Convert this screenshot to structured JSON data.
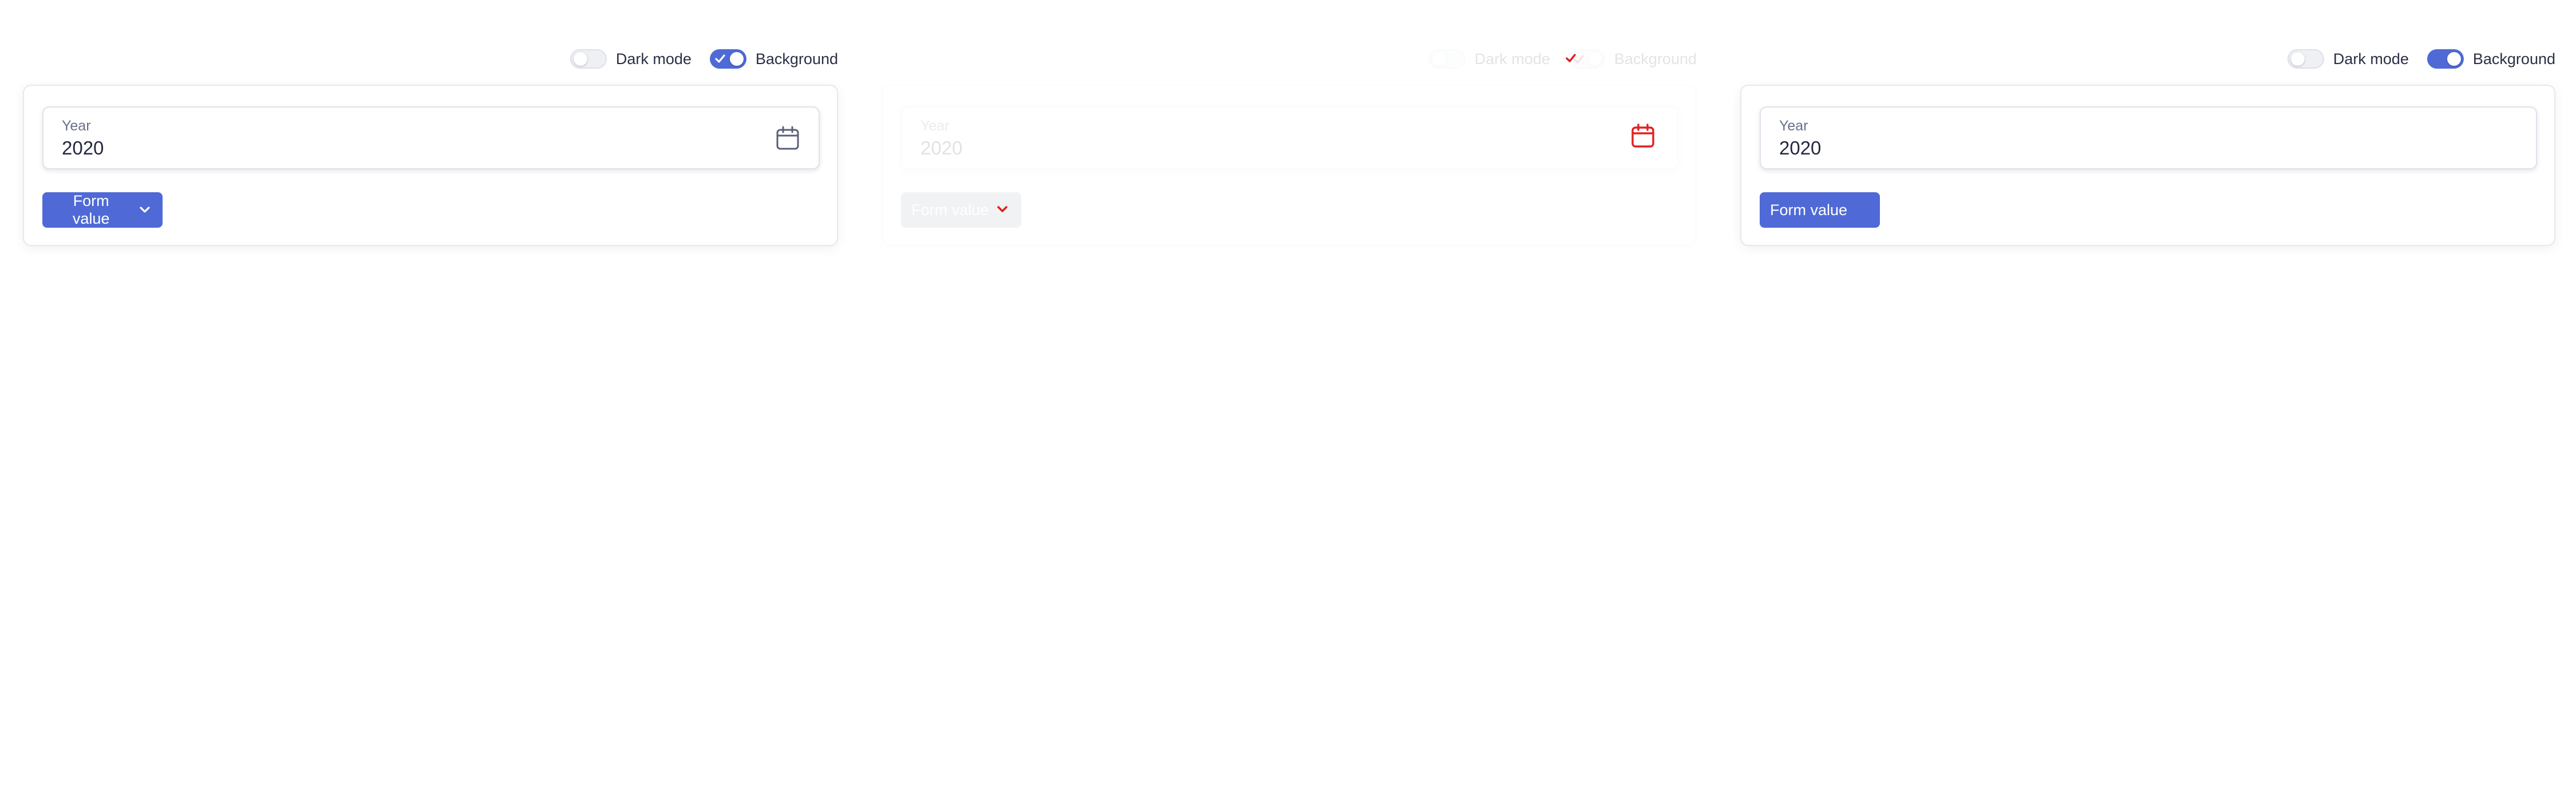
{
  "colors": {
    "accent": "#4f6ad6",
    "alert_red": "#e02020",
    "text": "#2b2f45",
    "muted": "#6b7088"
  },
  "panels": [
    {
      "toggles": {
        "dark_mode_label": "Dark mode",
        "dark_mode_on": false,
        "background_label": "Background",
        "background_on": true
      },
      "field": {
        "label": "Year",
        "value": "2020",
        "icon": "calendar-icon"
      },
      "button": {
        "label": "Form value",
        "icon": "chevron-down-icon"
      }
    },
    {
      "toggles": {
        "dark_mode_label": "Dark mode",
        "dark_mode_on": false,
        "background_label": "Background",
        "background_on": true
      },
      "field": {
        "label": "Year",
        "value": "2020",
        "icon": "calendar-icon"
      },
      "button": {
        "label": "Form value",
        "icon": "chevron-down-icon"
      }
    },
    {
      "toggles": {
        "dark_mode_label": "Dark mode",
        "dark_mode_on": false,
        "background_label": "Background",
        "background_on": true
      },
      "field": {
        "label": "Year",
        "value": "2020",
        "icon": "calendar-icon"
      },
      "button": {
        "label": "Form value"
      }
    }
  ]
}
